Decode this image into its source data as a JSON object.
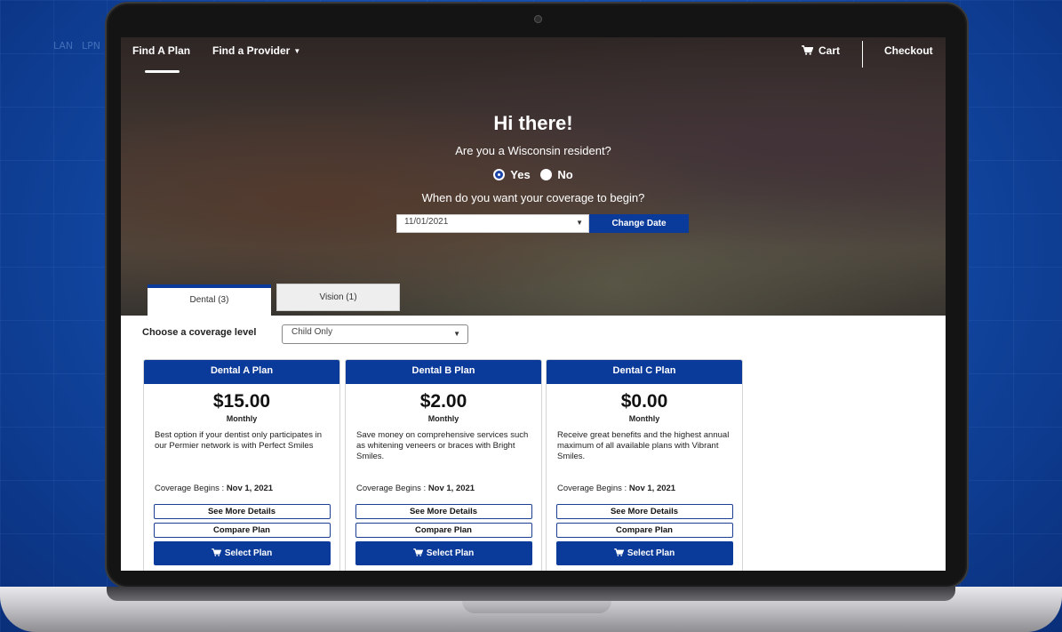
{
  "background": {
    "labels": [
      "LAN",
      "LPN"
    ]
  },
  "nav": {
    "find_plan": "Find A Plan",
    "find_provider": "Find a Provider",
    "cart": "Cart",
    "checkout": "Checkout"
  },
  "hero": {
    "title": "Hi there!",
    "question": "Are you a Wisconsin resident?",
    "yes": "Yes",
    "no": "No",
    "coverage_question": "When do you want your coverage to begin?",
    "date_value": "11/01/2021",
    "change_date": "Change Date"
  },
  "tabs": [
    {
      "label": "Dental (3)",
      "active": true
    },
    {
      "label": "Vision (1)",
      "active": false
    }
  ],
  "coverage": {
    "label": "Choose a coverage level",
    "selected": "Child Only"
  },
  "plans": [
    {
      "name": "Dental A Plan",
      "price": "$15.00",
      "period": "Monthly",
      "description": "Best option if your dentist only participates in our Permier network is with Perfect Smiles",
      "begins_label": "Coverage Begins :",
      "begins_date": "Nov 1, 2021",
      "details": "See More Details",
      "compare": "Compare Plan",
      "select": "Select Plan"
    },
    {
      "name": "Dental B Plan",
      "price": "$2.00",
      "period": "Monthly",
      "description": "Save money on comprehensive services such as whitening veneers or braces with Bright Smiles.",
      "begins_label": "Coverage Begins :",
      "begins_date": "Nov 1, 2021",
      "details": "See More Details",
      "compare": "Compare Plan",
      "select": "Select Plan"
    },
    {
      "name": "Dental C Plan",
      "price": "$0.00",
      "period": "Monthly",
      "description": "Receive great benefits and the highest annual maximum of all available plans with Vibrant Smiles.",
      "begins_label": "Coverage Begins :",
      "begins_date": "Nov 1, 2021",
      "details": "See More Details",
      "compare": "Compare Plan",
      "select": "Select Plan"
    }
  ],
  "colors": {
    "primary": "#0b3b9a",
    "background": "#124aa8"
  }
}
